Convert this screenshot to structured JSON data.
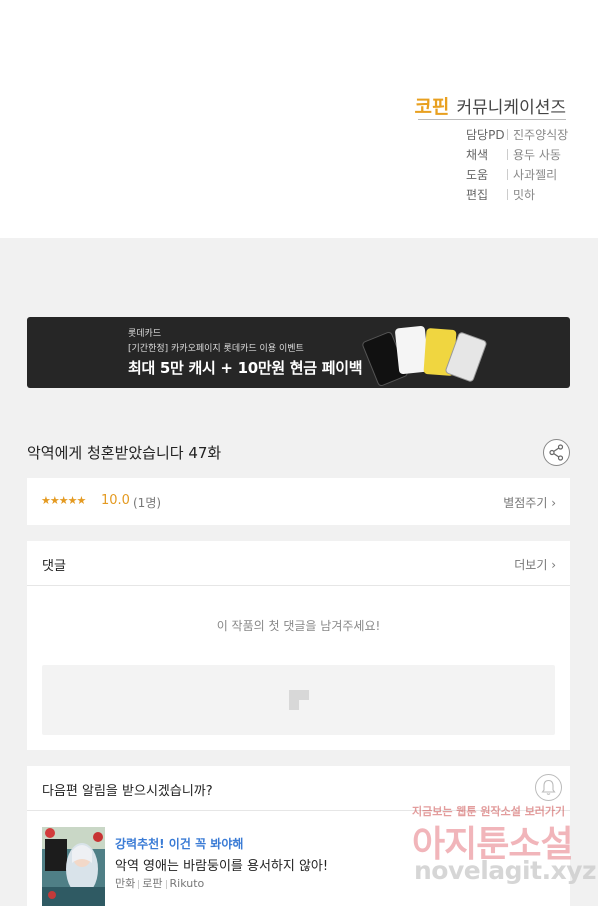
{
  "credits": {
    "studio_logo": "코핀",
    "studio_name": "커뮤니케이션즈",
    "rows": [
      {
        "role": "담당PD",
        "name": "진주양식장"
      },
      {
        "role": "채색",
        "name": "용두 사동"
      },
      {
        "role": "도움",
        "name": "사과젤리"
      },
      {
        "role": "편집",
        "name": "밋하"
      }
    ]
  },
  "banner": {
    "brand": "롯데카드",
    "subtitle": "[기간한정] 카카오페이지 롯데카드 이용 이벤트",
    "title": "최대 5만 캐시 + 10만원 현금 페이백"
  },
  "episode": {
    "title": "악역에게 청혼받았습니다 47화"
  },
  "rating": {
    "stars": "★★★★★",
    "score": "10.0",
    "count": "(1명)",
    "rate_label": "별점주기 ›"
  },
  "comments": {
    "label": "댓글",
    "more_label": "더보기 ›",
    "empty_message": "이 작품의 첫 댓글을 남겨주세요!"
  },
  "next_episode": {
    "prompt": "다음편 알림을 받으시겠습니까?"
  },
  "recommendation": {
    "tag": "강력추천! 이건 꼭 봐야해",
    "title": "악역 영애는 바람둥이를 용서하지 않아!",
    "genre": "만화",
    "category": "로판",
    "author": "Rikuto"
  },
  "watermark": {
    "top": "지금보는 웹툰 원작소설 보러가기",
    "main": "아지툰소설",
    "url": "novelagit.xyz"
  },
  "colors": {
    "accent": "#e49a21",
    "link_blue": "#3a7bd5",
    "banner_bg": "#262626",
    "page_bg": "#f1f1f1"
  },
  "icons": [
    "share-icon",
    "bell-icon",
    "image-placeholder-icon",
    "chevron-right-icon"
  ]
}
